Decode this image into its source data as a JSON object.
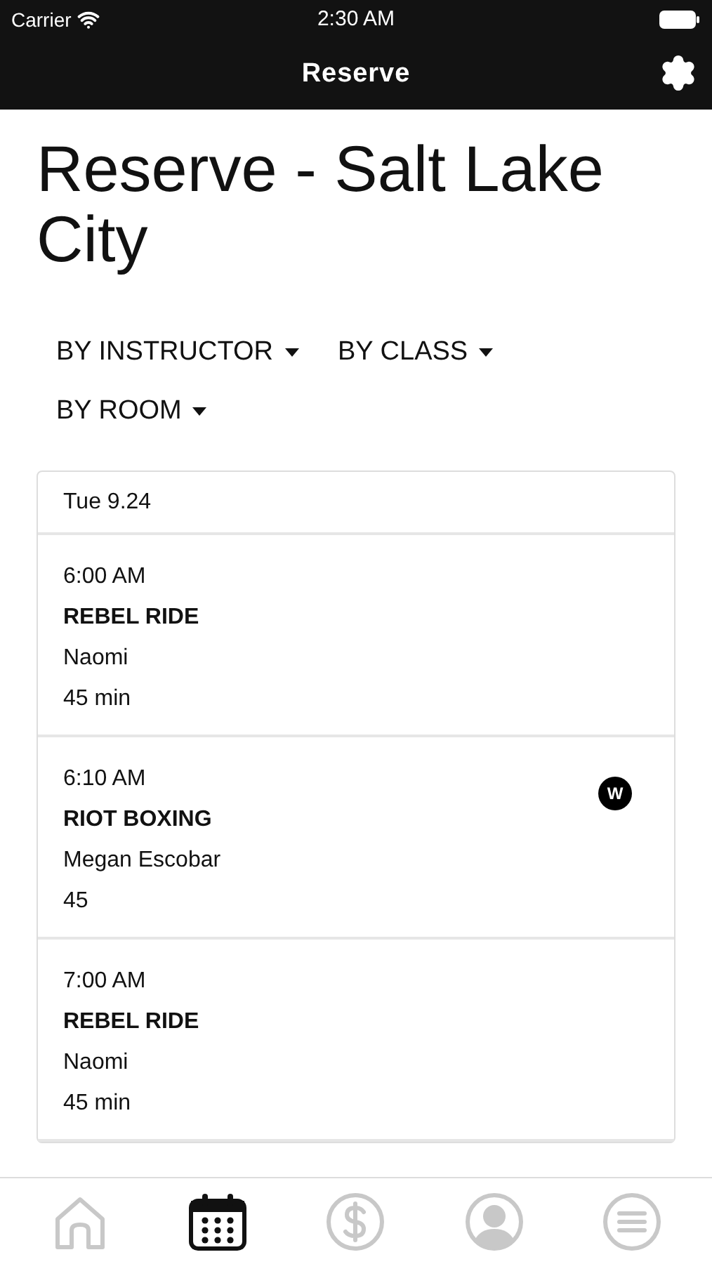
{
  "status_bar": {
    "carrier": "Carrier",
    "time": "2:30 AM"
  },
  "nav": {
    "title": "Reserve"
  },
  "page_title": "Reserve - Salt Lake City",
  "filters": [
    {
      "label": "BY INSTRUCTOR"
    },
    {
      "label": "BY CLASS"
    },
    {
      "label": "BY ROOM"
    }
  ],
  "schedule": {
    "date": "Tue 9.24",
    "classes": [
      {
        "time": "6:00 AM",
        "name": "REBEL RIDE",
        "instructor": "Naomi",
        "duration": "45 min"
      },
      {
        "time": "6:10 AM",
        "name": "RIOT BOXING",
        "instructor": "Megan Escobar",
        "duration": "45",
        "badge": "W"
      },
      {
        "time": "7:00 AM",
        "name": "REBEL RIDE",
        "instructor": "Naomi",
        "duration": "45 min"
      }
    ]
  },
  "tab_bar": [
    {
      "kind": "home",
      "selected": false
    },
    {
      "kind": "calendar",
      "selected": true
    },
    {
      "kind": "dollar",
      "selected": false
    },
    {
      "kind": "profile",
      "selected": false
    },
    {
      "kind": "menu",
      "selected": false
    }
  ]
}
